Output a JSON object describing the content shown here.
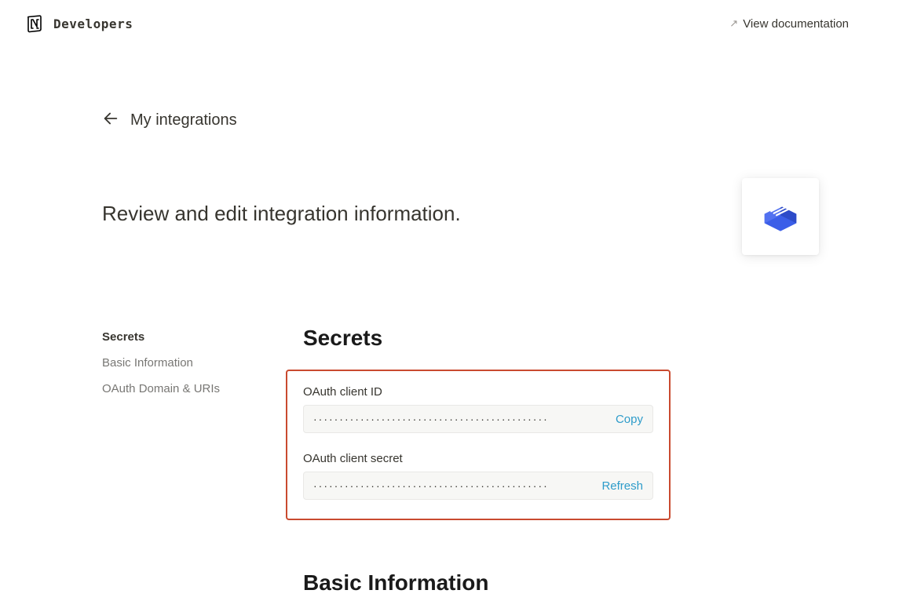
{
  "header": {
    "brand": "Developers",
    "view_docs_label": "View documentation"
  },
  "back": {
    "label": "My integrations"
  },
  "page": {
    "description": "Review and edit integration information."
  },
  "sidebar": {
    "items": [
      {
        "label": "Secrets",
        "active": true
      },
      {
        "label": "Basic Information",
        "active": false
      },
      {
        "label": "OAuth Domain & URIs",
        "active": false
      }
    ]
  },
  "secrets": {
    "title": "Secrets",
    "client_id": {
      "label": "OAuth client ID",
      "value": "·············································",
      "action": "Copy"
    },
    "client_secret": {
      "label": "OAuth client secret",
      "value": "·············································",
      "action": "Refresh"
    }
  },
  "basic_information": {
    "title": "Basic Information"
  }
}
